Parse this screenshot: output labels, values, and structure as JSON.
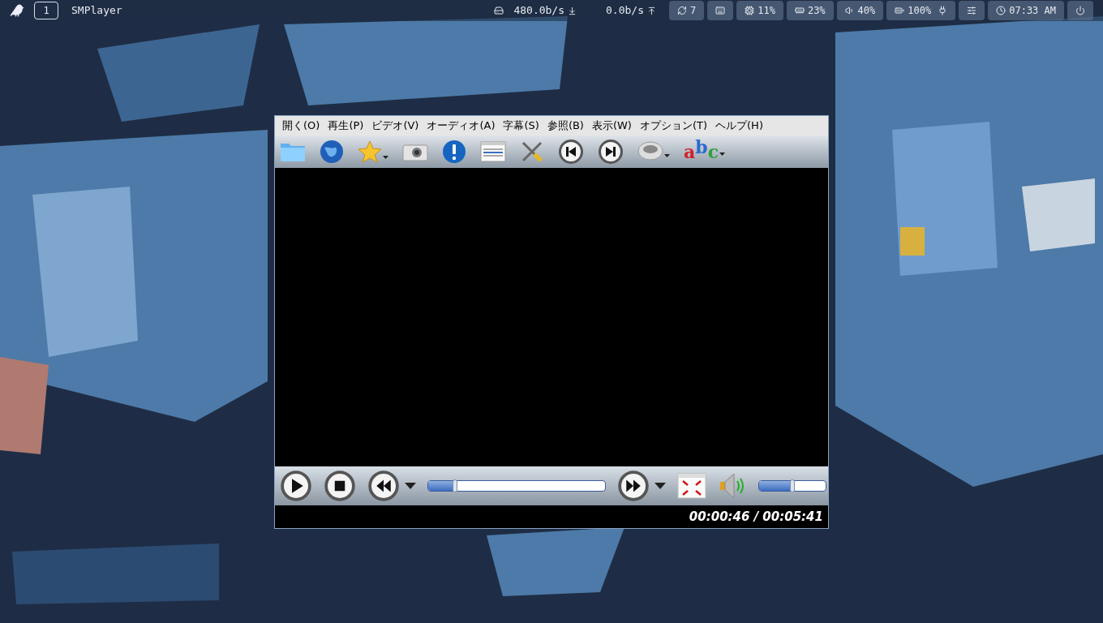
{
  "taskbar": {
    "workspace": "1",
    "window_title": "SMPlayer",
    "net_down": "480.0b/s",
    "net_up": "0.0b/s",
    "widgets": [
      {
        "kind": "updates",
        "text": "7"
      },
      {
        "kind": "keyboard"
      },
      {
        "kind": "cpu",
        "text": "11%"
      },
      {
        "kind": "memory",
        "text": "23%"
      },
      {
        "kind": "volume",
        "text": "40%"
      },
      {
        "kind": "battery",
        "text": "100%"
      },
      {
        "kind": "mixer"
      },
      {
        "kind": "clock",
        "text": "07:33 AM"
      },
      {
        "kind": "power"
      }
    ]
  },
  "player": {
    "menu": [
      "開く(O)",
      "再生(P)",
      "ビデオ(V)",
      "オーディオ(A)",
      "字幕(S)",
      "参照(B)",
      "表示(W)",
      "オプション(T)",
      "ヘルプ(H)"
    ],
    "toolbar": [
      {
        "kind": "open",
        "dropdown": false
      },
      {
        "kind": "url",
        "dropdown": false
      },
      {
        "kind": "favorites",
        "dropdown": true
      },
      {
        "kind": "screenshot",
        "dropdown": false
      },
      {
        "kind": "info",
        "dropdown": false
      },
      {
        "kind": "playlist",
        "dropdown": false
      },
      {
        "kind": "preferences",
        "dropdown": false
      },
      {
        "kind": "previous",
        "dropdown": false
      },
      {
        "kind": "next",
        "dropdown": false
      },
      {
        "kind": "audio",
        "dropdown": true
      },
      {
        "kind": "subtitles",
        "text": "abc",
        "dropdown": true
      }
    ],
    "controls": [
      {
        "kind": "play"
      },
      {
        "kind": "stop"
      },
      {
        "kind": "rewind",
        "dropdown": true
      },
      {
        "kind": "seek",
        "level": 0.15
      },
      {
        "kind": "forward",
        "dropdown": true
      },
      {
        "kind": "fullscreen"
      },
      {
        "kind": "mute"
      },
      {
        "kind": "volume",
        "level": 0.5
      }
    ],
    "time": "00:00:46 / 00:05:41"
  }
}
